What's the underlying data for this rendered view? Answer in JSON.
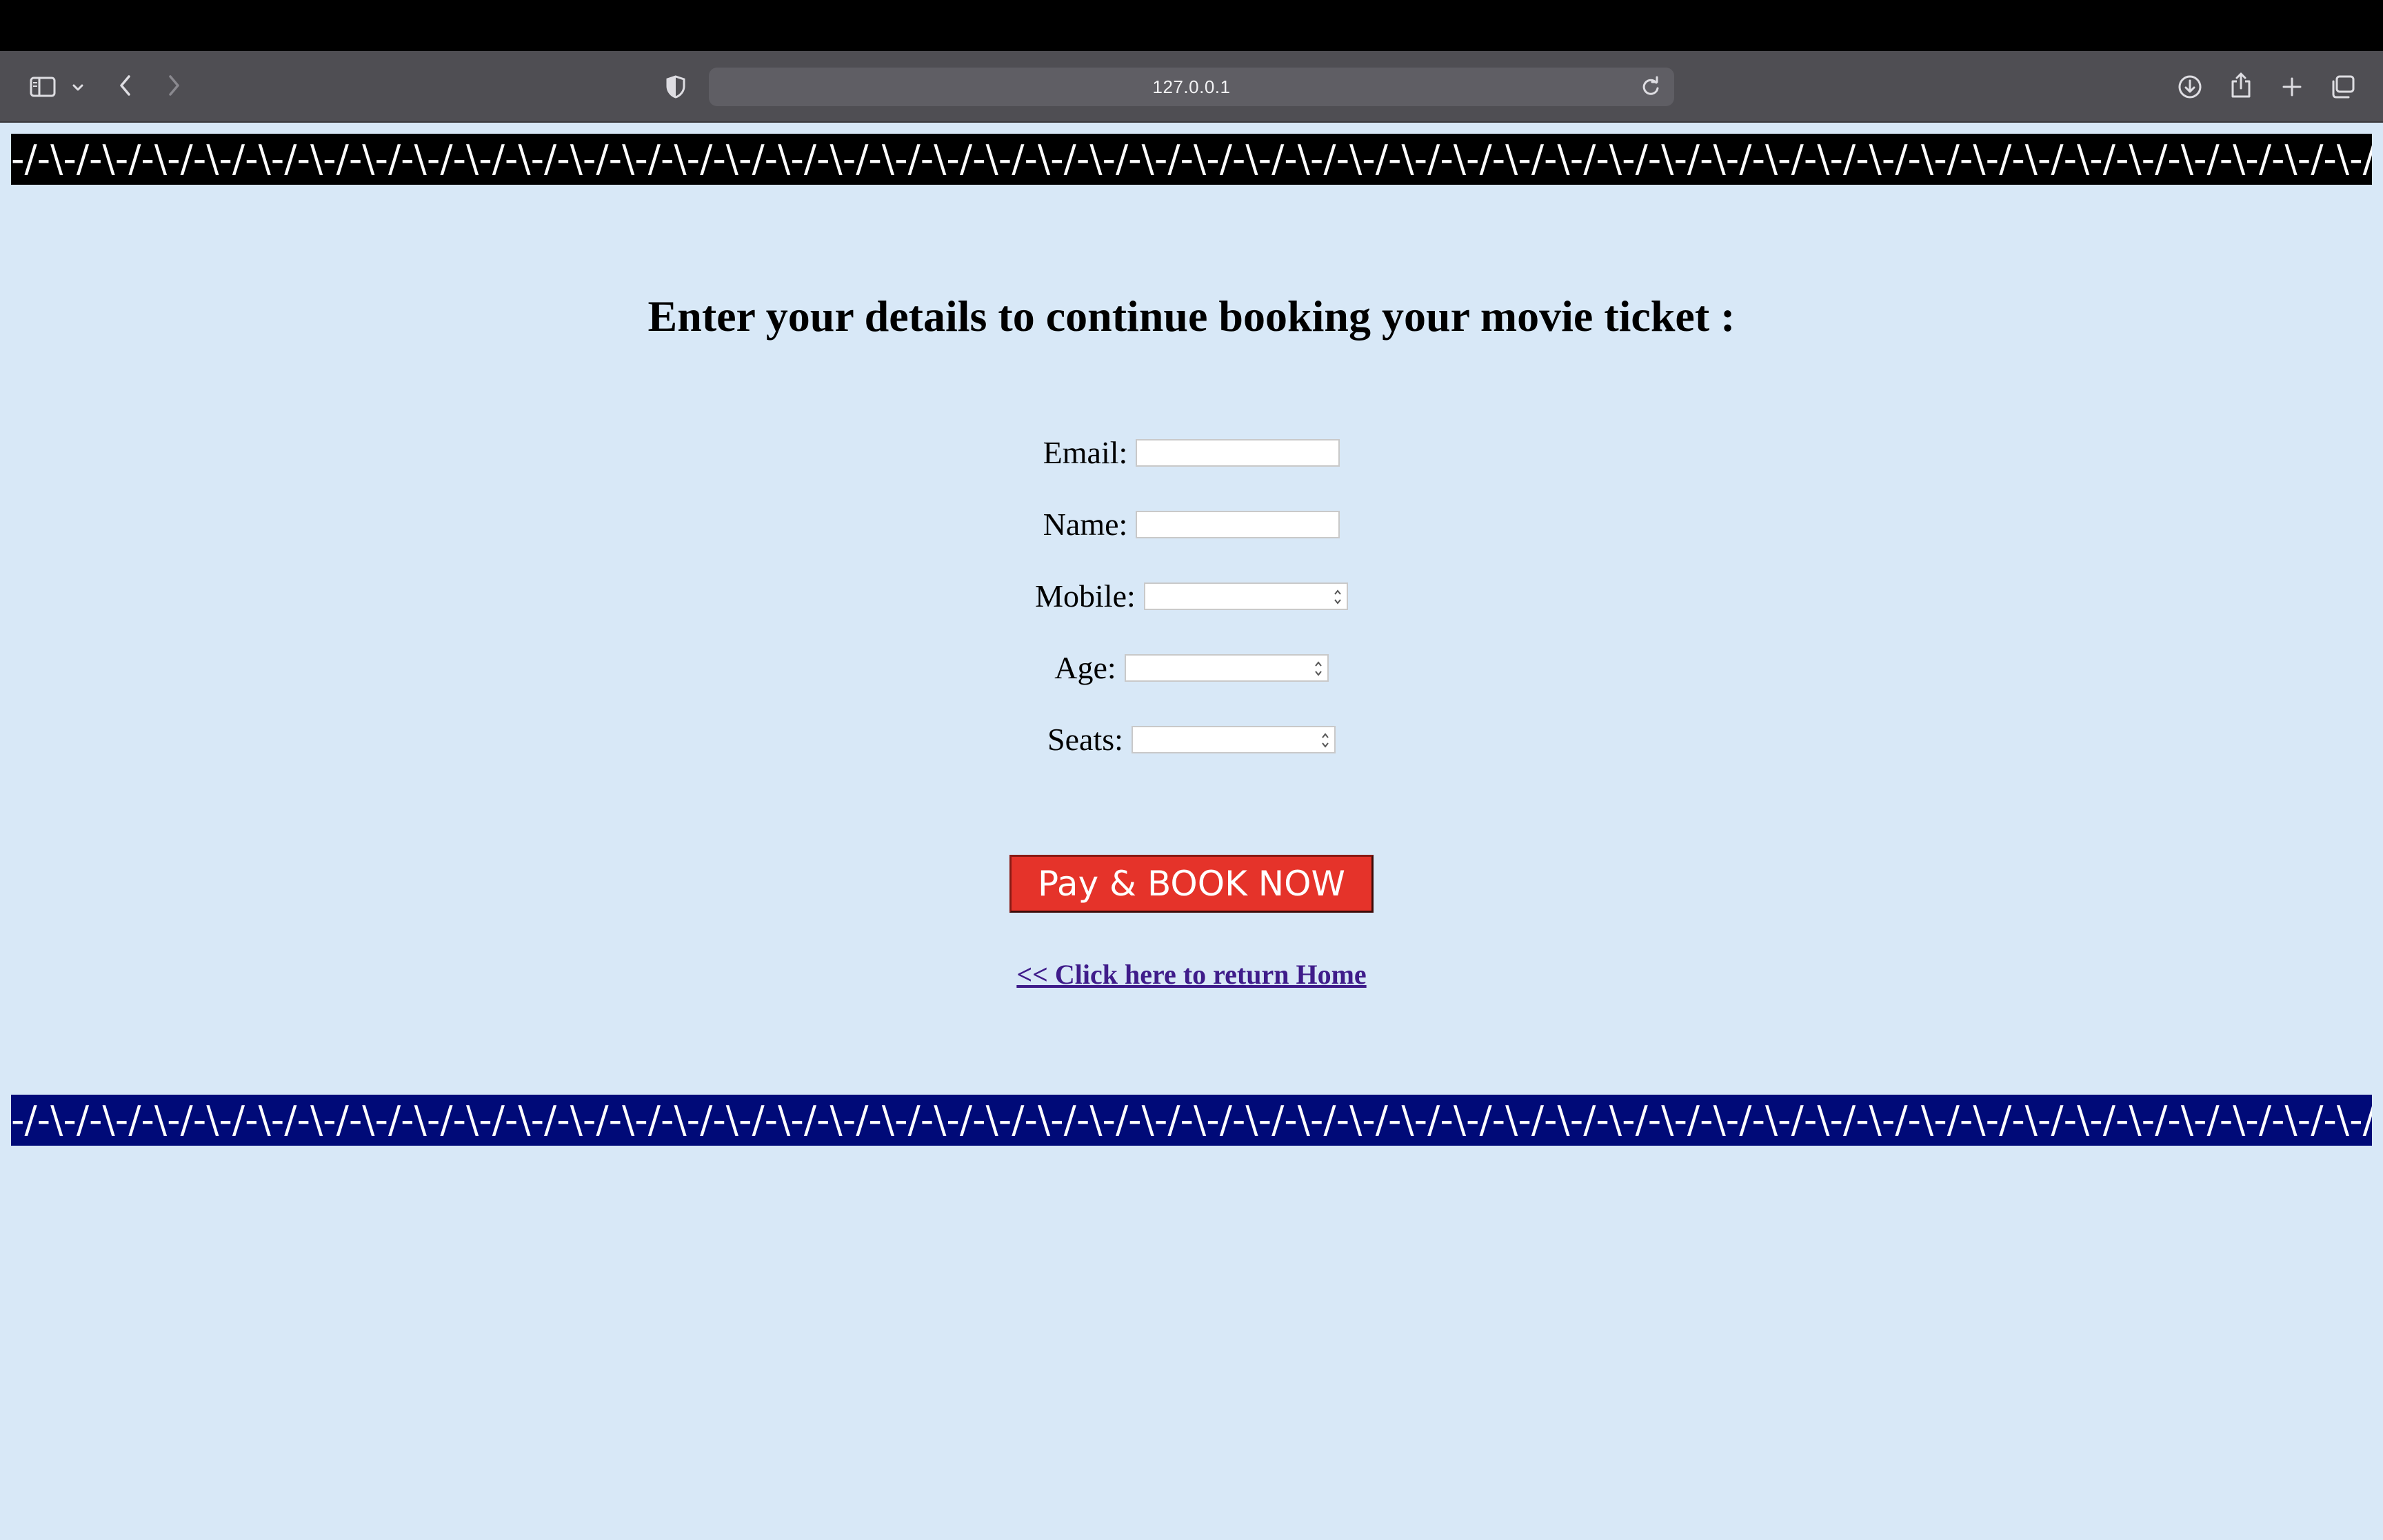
{
  "browser": {
    "url": "127.0.0.1",
    "icons": {
      "sidebar": "sidebar-icon",
      "sidebar_menu": "chevron-down-icon",
      "back": "chevron-left-icon",
      "forward": "chevron-right-icon",
      "privacy": "shield-icon",
      "reload": "reload-icon",
      "download": "download-icon",
      "share": "share-icon",
      "new_tab": "plus-icon",
      "tabs": "tabs-overview-icon"
    }
  },
  "page": {
    "marquee_text": "-/-\\-/-\\-/-\\-/-\\-/-\\-/-\\-/-\\-/-\\-/-\\-/-\\-/-\\-/-\\-/-\\-/-\\-/-\\-/-\\-/-\\-/-\\-/-\\-/-\\-/-\\-/-\\-/-\\-/-\\-/-\\-/-\\-/-\\-/-\\-/-\\-/-\\-/-\\-/-\\-/-\\-/-\\-/-\\-/-\\-/-\\-/-\\-/-\\-/-\\-/-\\-/-\\-/-\\-/-\\-/-\\-/-\\-/-\\-/-\\-/-\\-/-\\-/-\\-/-\\-/-\\-/-\\-/-\\-/-\\-/-\\-/-\\-/-\\-/-\\-/-\\-/-\\-/-\\-/-\\-/-\\-/-\\-/-\\-/-\\-/-\\-/-\\-/-\\-/-\\-/",
    "heading": "Enter your details to continue booking your movie ticket :",
    "form": {
      "email_label": "Email:",
      "email_value": "",
      "name_label": "Name:",
      "name_value": "",
      "mobile_label": "Mobile:",
      "age_label": "Age:",
      "seats_label": "Seats:"
    },
    "book_button_label": "Pay & BOOK NOW",
    "home_link_text": "<< Click here to return Home"
  },
  "colors": {
    "page_background": "#d8e8f7",
    "top_band": "#000000",
    "bottom_band": "#000a78",
    "button": "#e5332a",
    "link": "#3f1c8a"
  }
}
